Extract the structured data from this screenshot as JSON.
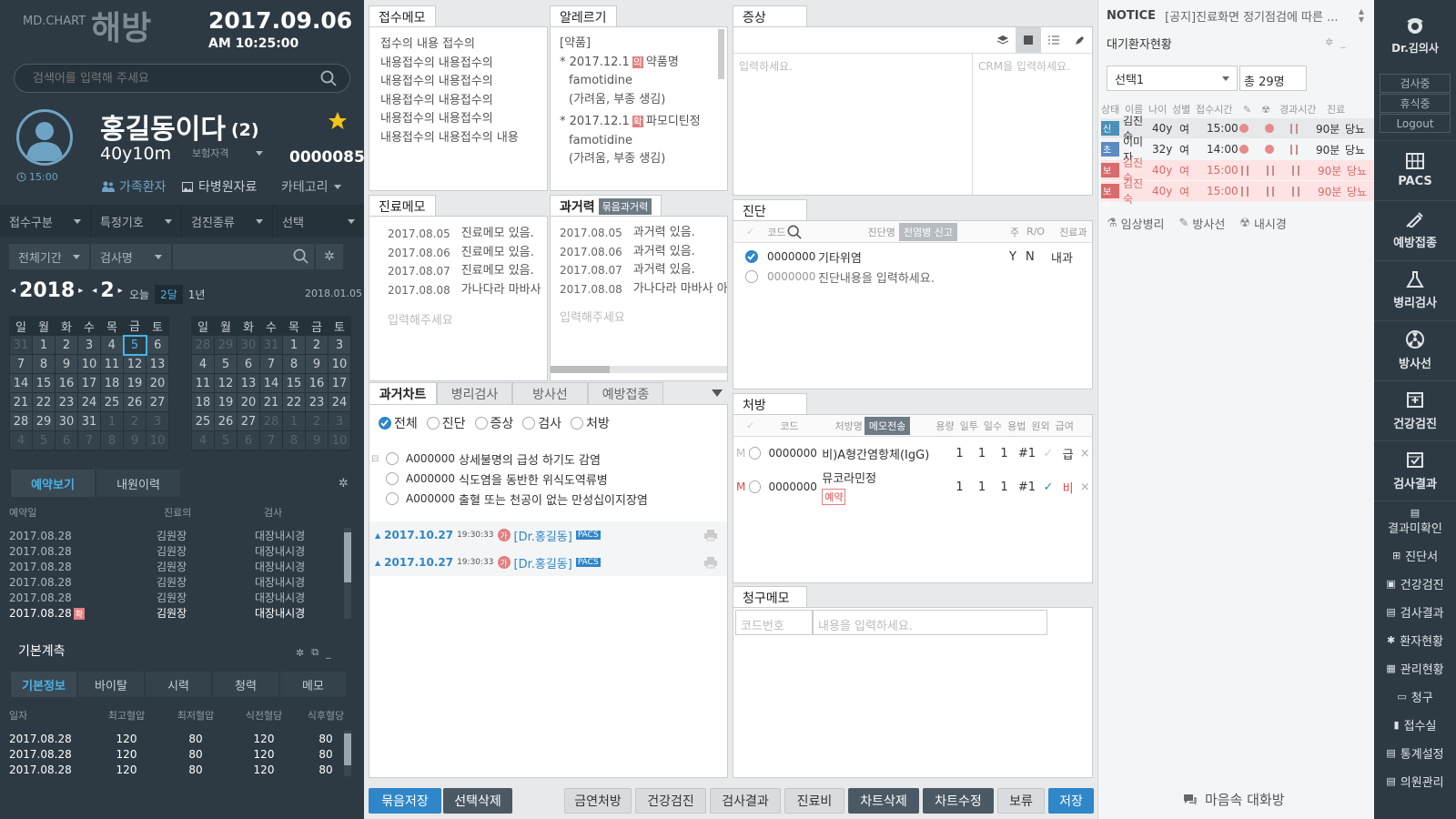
{
  "header": {
    "brand_small": "MD.CHART",
    "brand_big": "해방",
    "date": "2017.09.06",
    "time": "AM 10:25:00"
  },
  "search": {
    "placeholder": "검색어를 입력해 주세요"
  },
  "patient": {
    "name": "홍길동이다",
    "count": "(2)",
    "age": "40y10m",
    "insurance_label": "보험자격",
    "chart_no": "0000085",
    "visit_time": "15:00",
    "family_link": "가족환자",
    "other_hospital_link": "타병원자료",
    "category_label": "카테고리"
  },
  "filters": {
    "row1": [
      "접수구분",
      "특정기호",
      "검진종류",
      "선택"
    ],
    "period": "전체기간",
    "exam_name": "검사명"
  },
  "calendar": {
    "year": "2018",
    "month": "2",
    "range_today": "오늘",
    "range_2m": "2달",
    "range_1y": "1년",
    "selected_date": "2018.01.05",
    "weekdays": [
      "일",
      "월",
      "화",
      "수",
      "목",
      "금",
      "토"
    ],
    "left_weeks": [
      [
        "31",
        "1",
        "2",
        "3",
        "4",
        "5",
        "6"
      ],
      [
        "7",
        "8",
        "9",
        "10",
        "11",
        "12",
        "13"
      ],
      [
        "14",
        "15",
        "16",
        "17",
        "18",
        "19",
        "20"
      ],
      [
        "21",
        "22",
        "23",
        "24",
        "25",
        "26",
        "27"
      ],
      [
        "28",
        "29",
        "30",
        "31",
        "1",
        "2",
        "3"
      ],
      [
        "4",
        "5",
        "6",
        "7",
        "8",
        "9",
        "10"
      ]
    ],
    "right_weeks": [
      [
        "28",
        "29",
        "30",
        "31",
        "1",
        "2",
        "3"
      ],
      [
        "4",
        "5",
        "6",
        "7",
        "8",
        "9",
        "10"
      ],
      [
        "11",
        "12",
        "13",
        "14",
        "15",
        "16",
        "17"
      ],
      [
        "18",
        "19",
        "20",
        "21",
        "22",
        "23",
        "24"
      ],
      [
        "25",
        "26",
        "27",
        "28",
        "1",
        "2",
        "3"
      ],
      [
        "4",
        "5",
        "6",
        "7",
        "8",
        "9",
        "10"
      ]
    ]
  },
  "reservation": {
    "tab_active": "예약보기",
    "tab_other": "내원이력",
    "headers": [
      "예약일",
      "진료의",
      "검사"
    ],
    "rows": [
      {
        "date": "2017.08.28",
        "doctor": "김원장",
        "exam": "대장내시경"
      },
      {
        "date": "2017.08.28",
        "doctor": "김원장",
        "exam": "대장내시경"
      },
      {
        "date": "2017.08.28",
        "doctor": "김원장",
        "exam": "대장내시경"
      },
      {
        "date": "2017.08.28",
        "doctor": "김원장",
        "exam": "대장내시경"
      },
      {
        "date": "2017.08.28",
        "doctor": "김원장",
        "exam": "대장내시경"
      },
      {
        "date": "2017.08.28",
        "doctor": "김원장",
        "exam": "대장내시경",
        "badge": "확"
      }
    ]
  },
  "basic_measure": {
    "title": "기본계측",
    "tabs": [
      "기본정보",
      "바이탈",
      "시력",
      "청력",
      "메모"
    ],
    "headers": [
      "일자",
      "최고혈압",
      "최저혈압",
      "식전혈당",
      "식후혈당"
    ],
    "rows": [
      [
        "2017.08.28",
        "120",
        "80",
        "120",
        "80"
      ],
      [
        "2017.08.28",
        "120",
        "80",
        "120",
        "80"
      ],
      [
        "2017.08.28",
        "120",
        "80",
        "120",
        "80"
      ]
    ]
  },
  "reception_memo": {
    "title": "접수메모",
    "lines": [
      "접수의 내용 접수의",
      "내용접수의 내용접수의",
      "내용접수의 내용접수의",
      "내용접수의 내용접수의",
      "내용접수의 내용접수의",
      "내용접수의 내용접수의 내용"
    ]
  },
  "allergy": {
    "title": "알레르기",
    "section": "[약품]",
    "items": [
      {
        "date": "* 2017.12.1",
        "badge": "의",
        "name": "약품명",
        "drug": "famotidine",
        "note": "(가려움, 부종 생김)"
      },
      {
        "date": "* 2017.12.1",
        "badge": "확",
        "name": "파모디틴정",
        "drug": "famotidine",
        "note": "(가려움, 부종 생김)"
      }
    ]
  },
  "symptom": {
    "title": "증상",
    "placeholder": "입력하세요.",
    "crm_placeholder": "CRM을 입력하세요."
  },
  "clinic_memo": {
    "title": "진료메모",
    "rows": [
      {
        "date": "2017.08.05",
        "text": "진료메모 있음."
      },
      {
        "date": "2017.08.06",
        "text": "진료메모 있음."
      },
      {
        "date": "2017.08.07",
        "text": "진료메모 있음."
      },
      {
        "date": "2017.08.08",
        "text": "가나다라 마바사"
      }
    ],
    "placeholder": "입력해주세요"
  },
  "history": {
    "title": "과거력",
    "badge": "묶음과거력",
    "rows": [
      {
        "date": "2017.08.05",
        "text": "과거력 있음."
      },
      {
        "date": "2017.08.06",
        "text": "과거력 있음."
      },
      {
        "date": "2017.08.07",
        "text": "과거력 있음."
      },
      {
        "date": "2017.08.08",
        "text": "가나다라 마바사 아자"
      }
    ],
    "placeholder": "입력해주세요"
  },
  "diagnosis": {
    "title": "진단",
    "col_code": "코드",
    "col_name": "진단명",
    "report_btn": "전염병 신고",
    "col_main": "주",
    "col_ro": "R/O",
    "col_dept": "진료과",
    "rows": [
      {
        "code": "0000000",
        "name": "기타위염",
        "main": "Y",
        "ro": "N",
        "dept": "내과"
      },
      {
        "code": "0000000",
        "name": "진단내용을 입력하세요.",
        "main": "",
        "ro": "",
        "dept": ""
      }
    ]
  },
  "past_chart": {
    "tabs": [
      "과거차트",
      "병리검사",
      "방사선",
      "예방접종"
    ],
    "filters": [
      "전체",
      "진단",
      "증상",
      "검사",
      "처방"
    ],
    "items": [
      {
        "code": "A000000",
        "text": "상세불명의 급성 하기도 감염"
      },
      {
        "code": "A000000",
        "text": "식도염을 동반한 위식도역류병"
      },
      {
        "code": "A000000",
        "text": "출혈 또는 천공이 없는 만성십이지장염"
      }
    ],
    "visits": [
      {
        "date": "2017.10.27",
        "time": "19:30:33",
        "badge": "가",
        "doctor": "[Dr.홍길동]",
        "tag": "PACS"
      },
      {
        "date": "2017.10.27",
        "time": "19:30:33",
        "badge": "가",
        "doctor": "[Dr.홍길동]",
        "tag": "PACS"
      }
    ]
  },
  "prescription": {
    "title": "처방",
    "headers": [
      "코드",
      "처방명",
      "용량",
      "일투",
      "일수",
      "용법",
      "원외",
      "급여"
    ],
    "memo_btn": "메모전송",
    "rows": [
      {
        "flag": "M",
        "code": "0000000",
        "name": "비)A형간염항체(IgG)",
        "dose": "1",
        "daily": "1",
        "days": "1",
        "usage": "#1",
        "pay": "급",
        "extra": ""
      },
      {
        "flag": "M",
        "code": "0000000",
        "name": "뮤코라민정",
        "dose": "1",
        "daily": "1",
        "days": "1",
        "usage": "#1",
        "pay": "비",
        "extra": "예약"
      }
    ]
  },
  "claim_memo": {
    "title": "청구메모",
    "code_placeholder": "코드번호",
    "content_placeholder": "내용을 입력하세요."
  },
  "bottom_buttons": {
    "bundle_save": "묶음저장",
    "delete_selected": "선택삭제",
    "smoking": "금연처방",
    "checkup": "건강검진",
    "results": "검사결과",
    "fee": "진료비",
    "chart_delete": "차트삭제",
    "chart_edit": "차트수정",
    "hold": "보류",
    "save": "저장"
  },
  "notice": {
    "label": "NOTICE",
    "text": "[공지]진료화면 정기점검에 따른 ..."
  },
  "waiting": {
    "title": "대기환자현황",
    "select": "선택1",
    "total": "총 29명",
    "headers": [
      "상태",
      "이름",
      "나이",
      "성별",
      "접수시간",
      "경과시간",
      "진료"
    ],
    "rows": [
      {
        "status": "신",
        "name": "김진숙",
        "age": "40y",
        "sex": "여",
        "time": "15:00",
        "elapsed": "90분",
        "dept": "당뇨",
        "color": "#4a90b8"
      },
      {
        "status": "초",
        "name": "이미자",
        "age": "32y",
        "sex": "여",
        "time": "14:00",
        "elapsed": "90분",
        "dept": "당뇨",
        "color": "#5b8bc4"
      },
      {
        "status": "보류",
        "name": "김진숙",
        "age": "40y",
        "sex": "여",
        "time": "15:00",
        "elapsed": "90분",
        "dept": "당뇨",
        "color": "#d86b6b"
      },
      {
        "status": "보류",
        "name": "김진숙",
        "age": "40y",
        "sex": "여",
        "time": "15:00",
        "elapsed": "90분",
        "dept": "당뇨",
        "color": "#d86b6b"
      }
    ],
    "links": [
      "임상병리",
      "방사선",
      "내시경"
    ],
    "chat": "마음속 대화방"
  },
  "sidebar": {
    "doctor": "Dr.김의사",
    "status_buttons": [
      "검사중",
      "휴식중",
      "Logout"
    ],
    "big": [
      "PACS",
      "예방접종",
      "병리검사",
      "방사선",
      "건강검진",
      "검사결과"
    ],
    "small": [
      "결과미확인",
      "진단서",
      "건강검진",
      "검사결과",
      "환자현황",
      "관리현황",
      "청구",
      "접수실",
      "통계설정",
      "의원관리"
    ]
  },
  "colors": {
    "sidebar": "#2d3a43",
    "accent": "#2f86c9",
    "star": "#f5c518",
    "alert": "#e04848"
  }
}
